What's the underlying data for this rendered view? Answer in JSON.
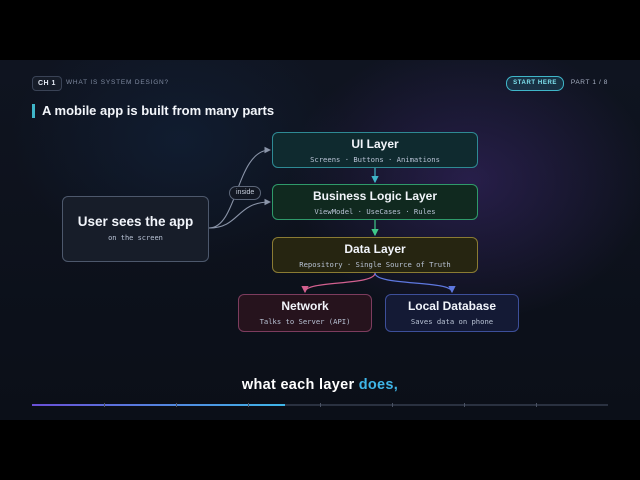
{
  "chapter": {
    "badge": "CH 1",
    "title": "WHAT IS SYSTEM DESIGN?"
  },
  "start_here": "START HERE",
  "part": "PART 1 / 8",
  "headline": "A mobile app is built from many parts",
  "nodes": {
    "user": {
      "title": "User sees the app",
      "subtitle": "on the screen"
    },
    "ui": {
      "title": "UI Layer",
      "subtitle": "Screens · Buttons · Animations"
    },
    "biz": {
      "title": "Business Logic Layer",
      "subtitle": "ViewModel · UseCases · Rules"
    },
    "data": {
      "title": "Data Layer",
      "subtitle": "Repository · Single Source of Truth"
    },
    "network": {
      "title": "Network",
      "subtitle": "Talks to Server (API)"
    },
    "local": {
      "title": "Local Database",
      "subtitle": "Saves data on phone"
    }
  },
  "edge_label": "inside",
  "caption": {
    "text": "what each layer",
    "highlight": "does,"
  },
  "progress": {
    "fraction": 0.44,
    "segments": 8
  },
  "colors": {
    "accent": "#3fb6c9",
    "ui_border": "#2e8a94",
    "biz_border": "#2f9a6a",
    "data_border": "#8a7b33",
    "network_border": "#7d3c5e",
    "local_border": "#3d4f9a",
    "network_arrow": "#d2608f",
    "local_arrow": "#5e78e0"
  }
}
